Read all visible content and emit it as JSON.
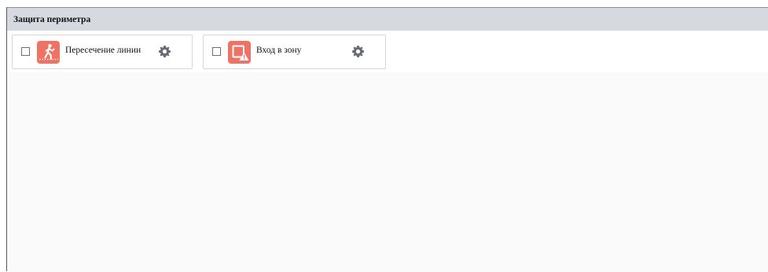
{
  "panel": {
    "title": "Защита периметра"
  },
  "colors": {
    "header_bg": "#d6dae0",
    "icon_tile": "#ee7365",
    "gear": "#666b74"
  },
  "items": [
    {
      "label": "Пересечение линии",
      "icon": "line-crossing-icon",
      "checked": false
    },
    {
      "label": "Вход в зону",
      "icon": "zone-entry-icon",
      "checked": false
    }
  ]
}
